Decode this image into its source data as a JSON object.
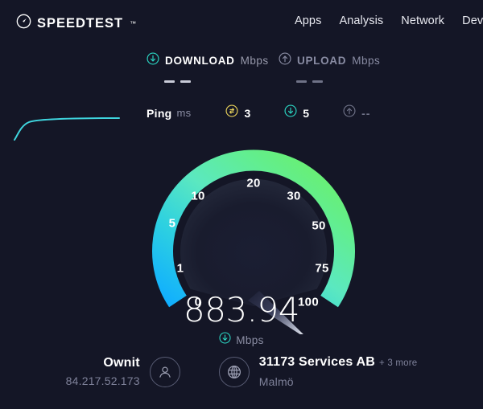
{
  "brand": {
    "name": "SPEEDTEST",
    "trademark": "™",
    "logo_icon": "speedometer-icon"
  },
  "nav": {
    "items": [
      {
        "label": "Apps"
      },
      {
        "label": "Analysis"
      },
      {
        "label": "Network"
      },
      {
        "label": "Deve"
      }
    ]
  },
  "metrics": {
    "download": {
      "label": "DOWNLOAD",
      "unit": "Mbps",
      "value": "—  —",
      "icon": "download-arrow-circle-icon",
      "active": true
    },
    "upload": {
      "label": "UPLOAD",
      "unit": "Mbps",
      "value": "—  —",
      "icon": "upload-arrow-circle-icon",
      "active": false
    }
  },
  "ping": {
    "title": "Ping",
    "unit": "ms",
    "idle": {
      "icon": "bidirectional-arrows-circle-icon",
      "value": "3",
      "color": "#e8d15a"
    },
    "download": {
      "icon": "download-arrow-circle-icon",
      "value": "5",
      "color": "#2bd7c4"
    },
    "upload": {
      "icon": "upload-arrow-circle-icon",
      "value": "--",
      "color": "#6f7287"
    }
  },
  "gauge": {
    "ticks": [
      "0",
      "1",
      "5",
      "10",
      "20",
      "30",
      "50",
      "75",
      "100"
    ],
    "arc_color_start": "#10AEFF",
    "arc_color_mid": "#5BE8C0",
    "arc_color_end": "#6EF060",
    "needle_position": "100"
  },
  "readout": {
    "value": "883.94",
    "unit": "Mbps",
    "unit_icon": "download-arrow-circle-icon"
  },
  "info": {
    "isp": {
      "name": "Ownit",
      "ip": "84.217.52.173",
      "icon": "person-circle-icon"
    },
    "server": {
      "name": "31173 Services AB",
      "more": "+ 3 more",
      "location": "Malmö",
      "icon": "globe-circle-icon"
    }
  },
  "colors": {
    "background": "#141626",
    "accent_cyan": "#2bd7c4",
    "accent_blue": "#10AEFF",
    "accent_green": "#6EF060",
    "accent_yellow": "#e8d15a",
    "text_muted": "#7e8199"
  }
}
